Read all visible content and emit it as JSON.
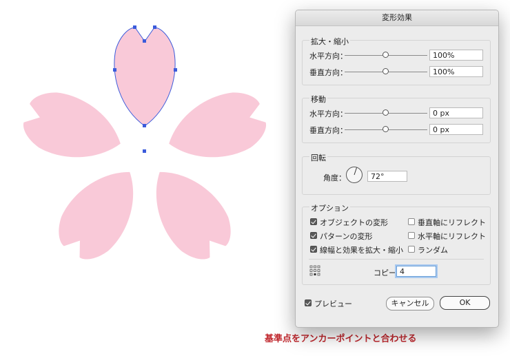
{
  "dialog": {
    "title": "変形効果",
    "scale": {
      "label": "拡大・縮小",
      "horizontal_label": "水平方向：",
      "horizontal_value": "100%",
      "vertical_label": "垂直方向：",
      "vertical_value": "100%"
    },
    "move": {
      "label": "移動",
      "horizontal_label": "水平方向：",
      "horizontal_value": "0 px",
      "vertical_label": "垂直方向：",
      "vertical_value": "0 px"
    },
    "rotate": {
      "label": "回転",
      "angle_label": "角度：",
      "angle_value": "72°"
    },
    "options": {
      "label": "オプション",
      "transform_objects": {
        "label": "オブジェクトの変形",
        "checked": true
      },
      "transform_patterns": {
        "label": "パターンの変形",
        "checked": true
      },
      "scale_strokes": {
        "label": "線幅と効果を拡大・縮小",
        "checked": true
      },
      "reflect_vertical": {
        "label": "垂直軸にリフレクト",
        "checked": false
      },
      "reflect_horizontal": {
        "label": "水平軸にリフレクト",
        "checked": false
      },
      "random": {
        "label": "ランダム",
        "checked": false
      }
    },
    "copies_label": "コピー",
    "copies_value": "4",
    "preview": {
      "label": "プレビュー",
      "checked": true
    },
    "cancel_label": "キャンセル",
    "ok_label": "OK"
  },
  "annotation": {
    "text": "基準点をアンカーポイントと合わせる",
    "color": "#c0272d"
  },
  "colors": {
    "petal_fill": "#f9c9d8",
    "selection": "#3b5bdb"
  }
}
